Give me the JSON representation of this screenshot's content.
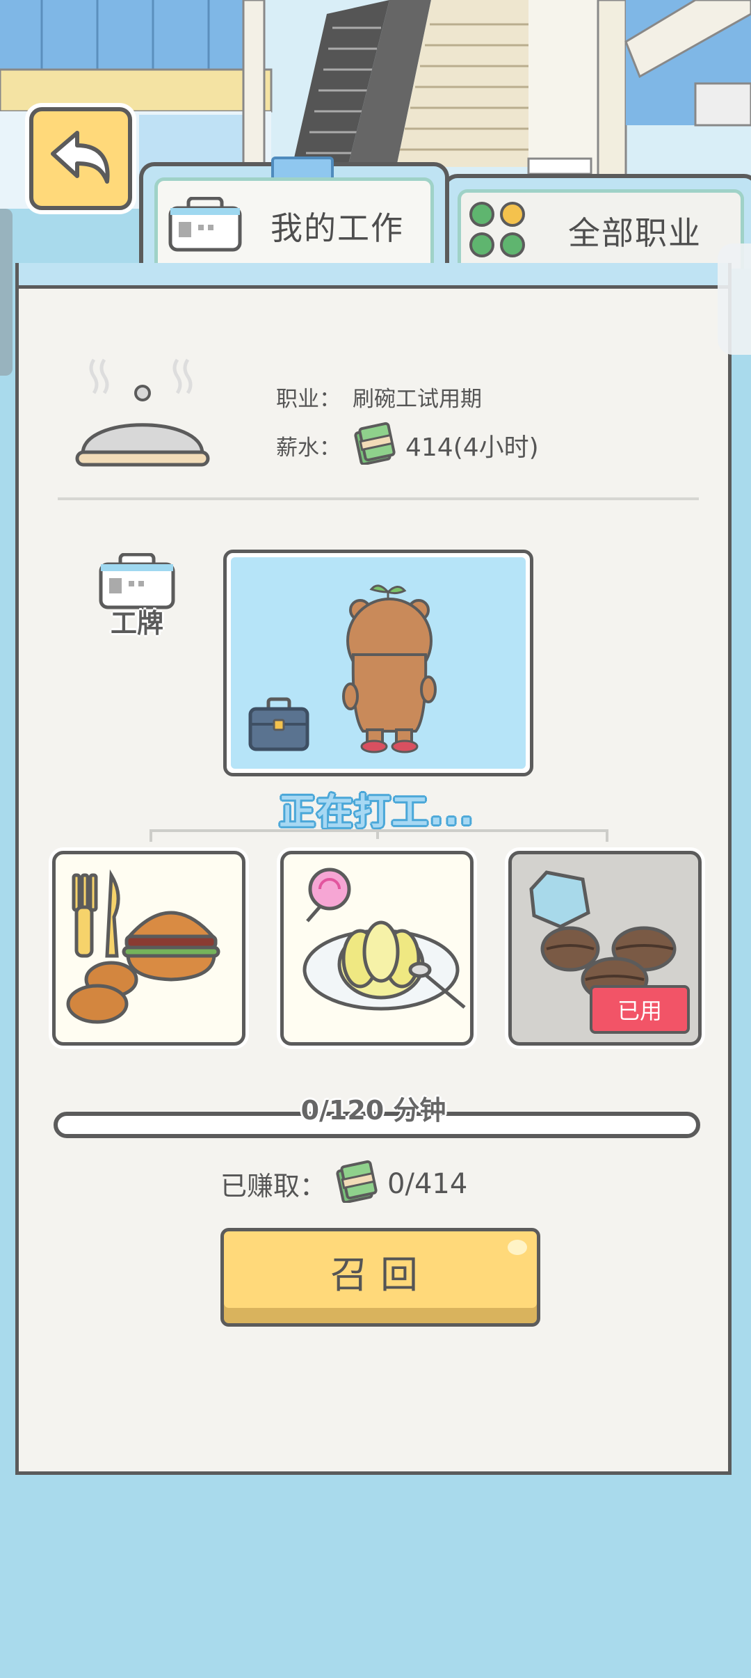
{
  "tabs": {
    "my_job": "我的工作",
    "all_jobs": "全部职业"
  },
  "job": {
    "occupation_label": "职业：",
    "occupation_value": "刷碗工试用期",
    "salary_label": "薪水：",
    "salary_value": "414(4小时)"
  },
  "badge": {
    "label": "工牌"
  },
  "status": {
    "working_text": "正在打工..."
  },
  "items": [
    {
      "name": "burger-meal",
      "used": false
    },
    {
      "name": "jelly-dessert",
      "used": false
    },
    {
      "name": "coffee-beans",
      "used": true,
      "used_label": "已用"
    }
  ],
  "progress": {
    "text": "0/120 分钟",
    "current": 0,
    "total": 120,
    "fraction": 0
  },
  "earned": {
    "label": "已赚取：",
    "value": "0/414"
  },
  "recall_button": {
    "label": "召回"
  },
  "colors": {
    "background": "#a9daec",
    "accent_yellow": "#ffd97a",
    "used_red": "#f25467",
    "working_blue": "#4aa7d8"
  }
}
